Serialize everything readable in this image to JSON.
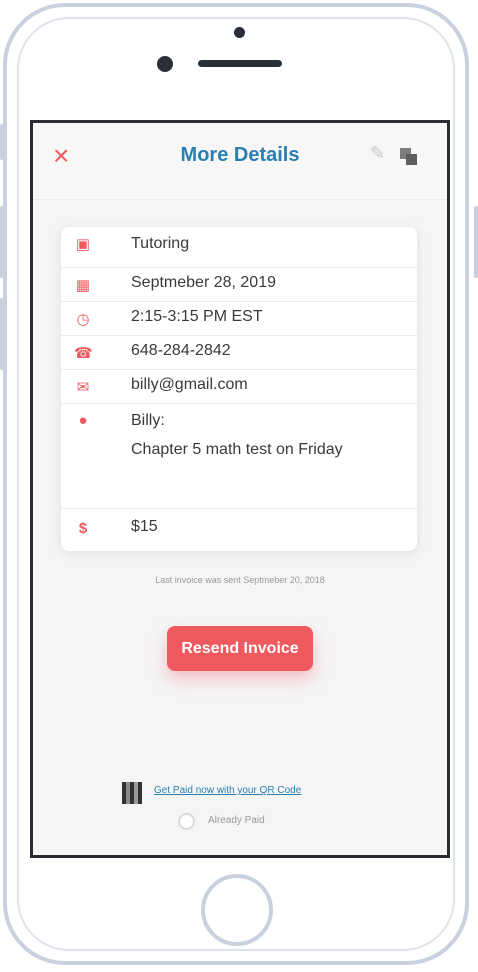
{
  "header": {
    "title": "More Details",
    "close_icon": "close-icon",
    "edit_icon": "pencil-icon",
    "copy_icon": "copy-icon"
  },
  "details": {
    "service": "Tutoring",
    "date": "Septmeber 28, 2019",
    "time": "2:15-3:15 PM EST",
    "phone": "648-284-2842",
    "email": "billy@gmail.com",
    "client_name": "Billy:",
    "note": "Chapter 5 math test on Friday",
    "price": "$15"
  },
  "invoice": {
    "last_sent_text": "Last invoice was sent Septmeber 20, 2018",
    "resend_label": "Resend Invoice"
  },
  "payment": {
    "qr_link_text": "Get Paid now with your QR Code",
    "already_paid_label": "Already Paid"
  },
  "colors": {
    "accent": "#ef5a5f",
    "title": "#2a7fb0"
  }
}
